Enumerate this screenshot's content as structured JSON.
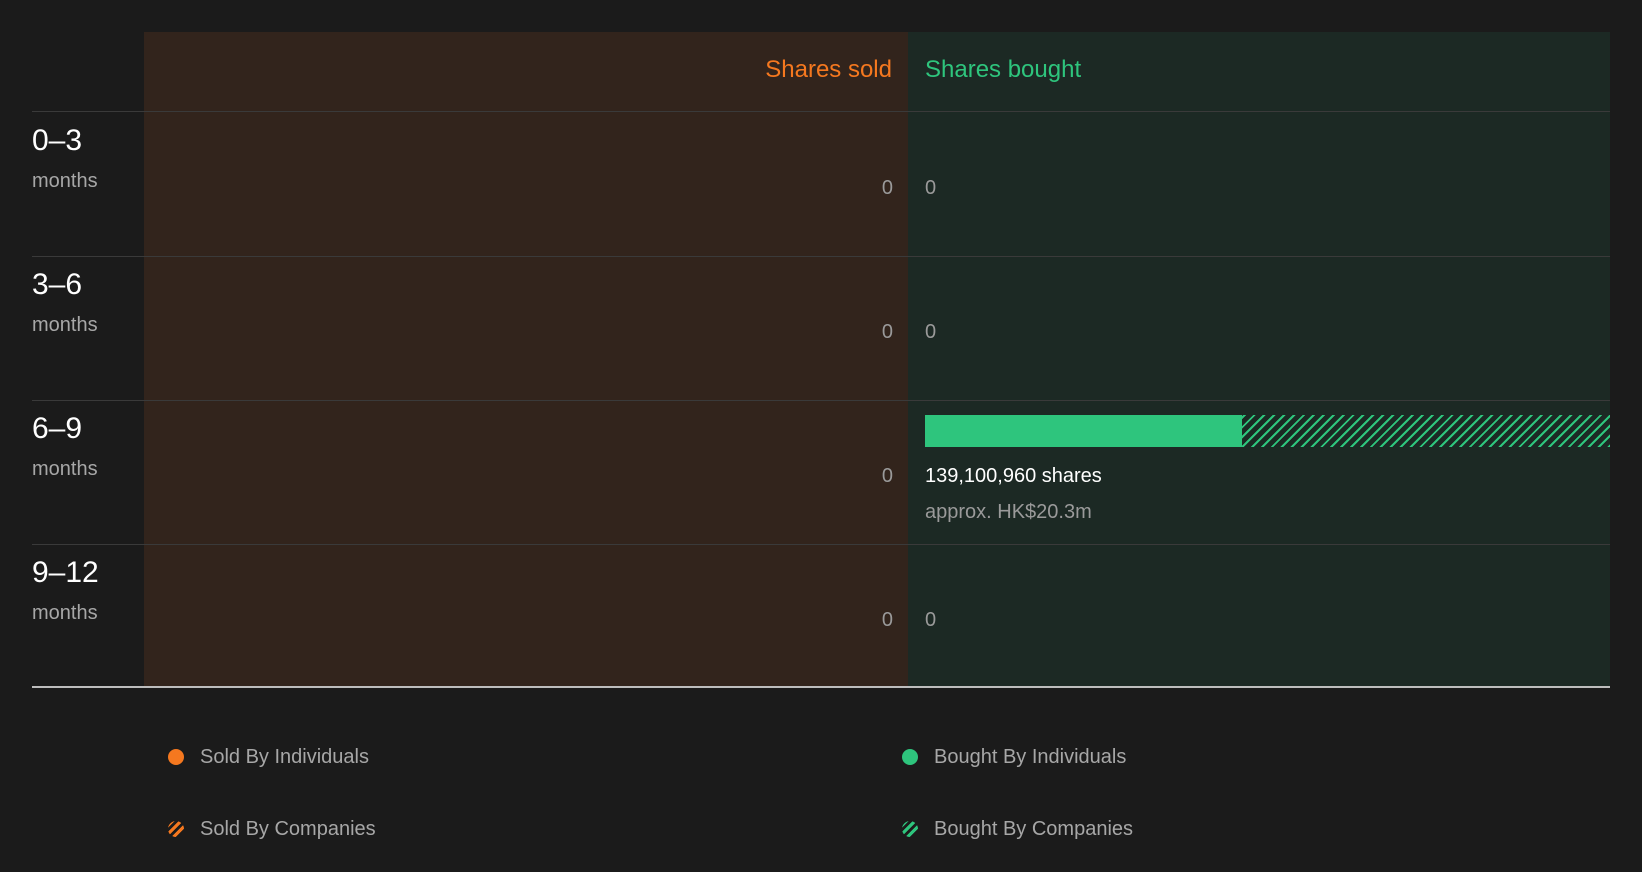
{
  "colors": {
    "sold": "#f5781f",
    "bought": "#2ec57d",
    "sold_panel": "#32241c",
    "bought_panel": "#1c2924",
    "background": "#1b1b1b"
  },
  "chart_data": {
    "type": "bar",
    "title": "",
    "columns": {
      "sold": "Shares sold",
      "bought": "Shares bought"
    },
    "categories": [
      "0–3",
      "3–6",
      "6–9",
      "9–12"
    ],
    "category_unit": "months",
    "rows": [
      {
        "label": "0–3",
        "unit": "months",
        "sold": "0",
        "bought": "0",
        "bought_value_text": "",
        "bought_bar": null
      },
      {
        "label": "3–6",
        "unit": "months",
        "sold": "0",
        "bought": "0",
        "bought_value_text": "",
        "bought_bar": null
      },
      {
        "label": "6–9",
        "unit": "months",
        "sold": "0",
        "bought": "139,100,960 shares",
        "bought_value_text": "approx. HK$20.3m",
        "bought_bar": {
          "individuals_fraction": 0.463,
          "companies_fraction": 0.537
        }
      },
      {
        "label": "9–12",
        "unit": "months",
        "sold": "0",
        "bought": "0",
        "bought_value_text": "",
        "bought_bar": null
      }
    ],
    "series": [
      {
        "name": "Sold By Individuals",
        "values": [
          0,
          0,
          0,
          0
        ]
      },
      {
        "name": "Sold By Companies",
        "values": [
          0,
          0,
          0,
          0
        ]
      },
      {
        "name": "Bought By Individuals",
        "values": [
          0,
          0,
          64400000,
          0
        ]
      },
      {
        "name": "Bought By Companies",
        "values": [
          0,
          0,
          74700000,
          0
        ]
      }
    ],
    "legend": [
      {
        "name": "Sold By Individuals",
        "style": "solid",
        "color": "#f5781f"
      },
      {
        "name": "Bought By Individuals",
        "style": "solid",
        "color": "#2ec57d"
      },
      {
        "name": "Sold By Companies",
        "style": "hatched",
        "color": "#f5781f"
      },
      {
        "name": "Bought By Companies",
        "style": "hatched",
        "color": "#2ec57d"
      }
    ],
    "legend_placement": "bottom"
  }
}
